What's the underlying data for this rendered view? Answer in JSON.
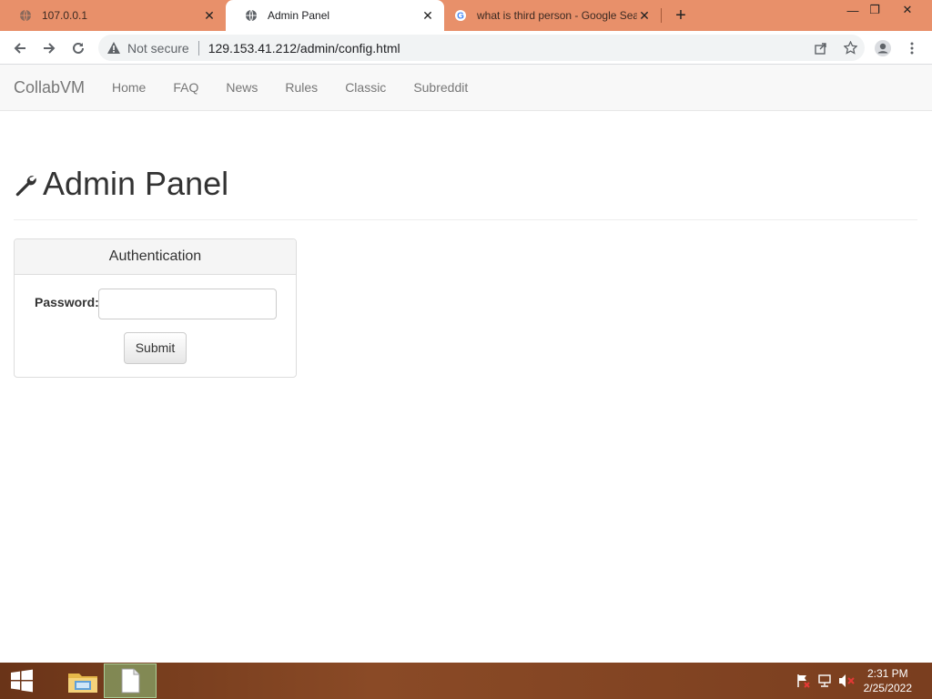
{
  "browser": {
    "tabs": [
      {
        "title": "107.0.0.1",
        "favicon": "globe-icon",
        "active": false
      },
      {
        "title": "Admin Panel",
        "favicon": "globe-icon",
        "active": true
      },
      {
        "title": "what is third person - Google Sea",
        "favicon": "google-icon",
        "active": false
      }
    ],
    "security_label": "Not secure",
    "url": "129.153.41.212/admin/config.html",
    "colors": {
      "titlebar": "#e8906a",
      "active_tab": "#ffffff"
    }
  },
  "site": {
    "brand": "CollabVM",
    "nav": [
      "Home",
      "FAQ",
      "News",
      "Rules",
      "Classic",
      "Subreddit"
    ]
  },
  "page": {
    "title": "Admin Panel",
    "panel": {
      "heading": "Authentication",
      "password_label": "Password:",
      "password_value": "",
      "submit_label": "Submit"
    }
  },
  "taskbar": {
    "time": "2:31 PM",
    "date": "2/25/2022"
  }
}
